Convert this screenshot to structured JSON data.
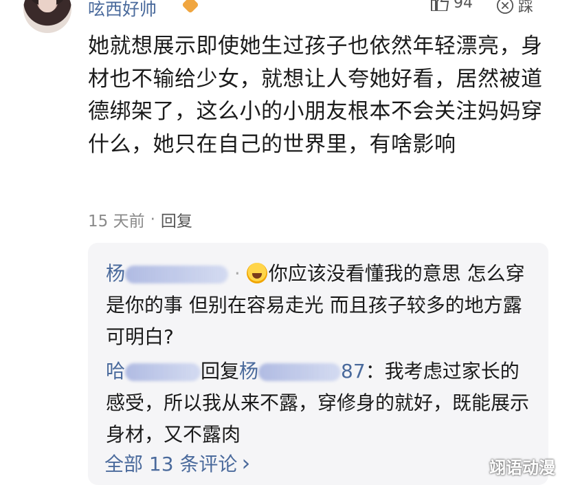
{
  "comment": {
    "username": "呟西好帅",
    "like_count": "94",
    "dislike_label": "踩",
    "text": "她就想展示即使她生过孩子也依然年轻漂亮，身材也不输给少女，就想让人夸她好看，居然被道德绑架了，这么小的小朋友根本不会关注妈妈穿什么，她只在自己的世界里，有啥影响",
    "time": "15 天前",
    "separator": "·",
    "reply_label": "回复"
  },
  "replies": {
    "reply1": {
      "author_visible": "杨",
      "text": "你应该没看懂我的意思 怎么穿是你的事 但别在容易走光 而且孩子较多的地方露 可明白?"
    },
    "reply2": {
      "author_visible": "哈",
      "reply_word": "回复",
      "target_visible": "杨",
      "target_suffix": "87",
      "colon": "：",
      "text": "我考虑过家长的感受，所以我从来不露，穿修身的就好，既能展示身材，又不露肉"
    },
    "all_comments_label": "全部 13 条评论",
    "chevron": "›"
  },
  "watermark": "翊语动漫",
  "colors": {
    "link_blue": "#4a6a9c",
    "reply_bg": "#f5f5f7",
    "meta_gray": "#8a8a8a"
  }
}
